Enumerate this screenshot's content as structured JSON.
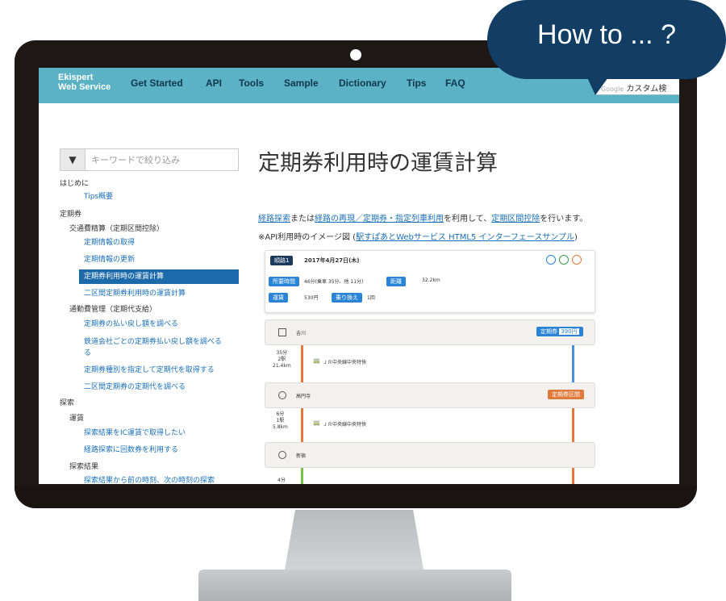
{
  "bubble": {
    "text": "How to ... ?"
  },
  "nav": {
    "logo_line1": "Ekispert",
    "logo_line2": "Web Service",
    "items": [
      "Get Started",
      "API",
      "Tools",
      "Sample",
      "Dictionary",
      "Tips",
      "FAQ"
    ],
    "search_brand": "Google",
    "search_text": "カスタム検"
  },
  "sidebar": {
    "filter_icon": "funnel-icon",
    "filter_placeholder": "キーワードで絞り込み",
    "items": [
      "はじめに",
      "Tips概要",
      "定期券",
      "交通費精算（定期区間控除）",
      "定期情報の取得",
      "定期情報の更新",
      "定期券利用時の運賃計算",
      "二区間定期券利用時の運賃計算",
      "通勤費管理（定期代支給）",
      "定期券の払い戻し額を調べる",
      "鉄道会社ごとの定期券払い戻し額を調べる",
      "る",
      "定期券種別を指定して定期代を取得する",
      "二区間定期券の定期代を調べる",
      "探索",
      "運賃",
      "探索結果をIC運賃で取得したい",
      "経路探索に回数券を利用する",
      "探索結果",
      "探索結果から前の時刻、次の時刻の探索"
    ]
  },
  "main": {
    "title": "定期券利用時の運賃計算",
    "para1": {
      "link1": "経路探索",
      "t1": "または",
      "link2": "経路の再現／定期券・指定列車利用",
      "t2": "を利用して、",
      "link3": "定期区間控除",
      "t3": "を行います。"
    },
    "para2": {
      "t1": "※API利用時のイメージ図 (",
      "link": "駅すぱあとWebサービス HTML5 インターフェースサンプル",
      "t2": ")"
    },
    "route": {
      "badge": "順路1",
      "date": "2017年4月27日(木)",
      "labels": [
        "所要時間",
        "距離",
        "運賃",
        "乗り換え"
      ],
      "time_value": "46分(乗車 35分、他 11分)",
      "distance_value": "32.2km",
      "fare_value": "530円",
      "transfer_value": "1回",
      "stop1": "吉川",
      "teiki_tag": "定期券",
      "teiki_price": "390円",
      "seg1": [
        "35分",
        "2駅",
        "21.4km"
      ],
      "line1": "ＪＲ中央線中央特快",
      "stop2": "高円寺",
      "kukan_tag": "定期券区間",
      "seg2": [
        "6分",
        "1駅",
        "5.8km"
      ],
      "line2": "ＪＲ中央線中央特快",
      "stop3": "新宿",
      "seg3": "4分"
    }
  }
}
